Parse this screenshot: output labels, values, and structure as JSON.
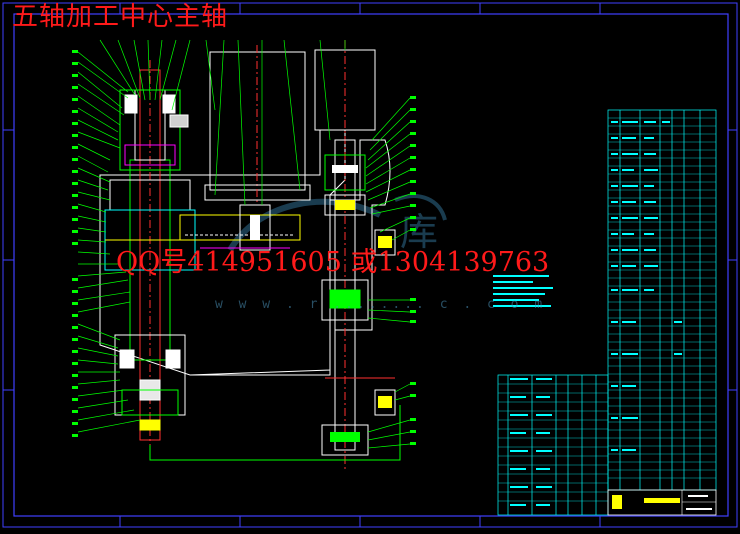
{
  "drawing": {
    "title": "五轴加工中心主轴",
    "contact": "QQ号414951605 或1304139763",
    "watermark_url": "w w w . r ........ c . c o m"
  },
  "colors": {
    "background": "#000000",
    "frame": "#4040ff",
    "part_lines": "#ffffff",
    "leaders": "#00ff00",
    "table_lines": "#00ffff",
    "title_red": "#ff1a1a",
    "watermark": "#4a8fb4"
  },
  "icons": {
    "watermark_logo": "swoosh-logo-icon"
  }
}
